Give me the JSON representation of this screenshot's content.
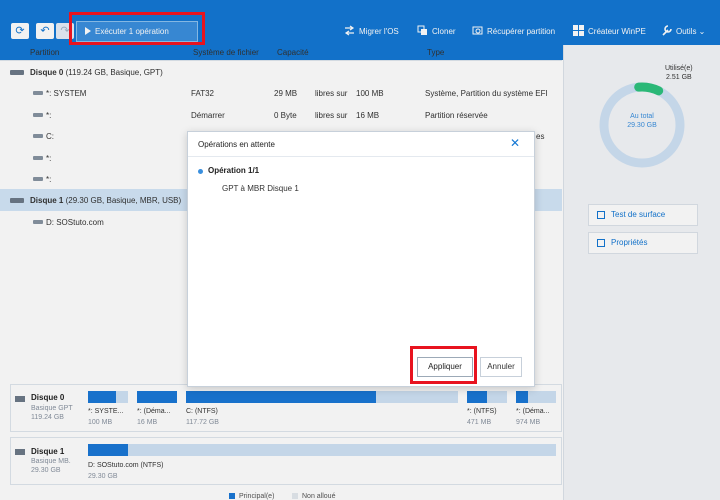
{
  "toolbar": {
    "refresh_icon": "refresh-icon",
    "undo_icon": "undo-icon",
    "redo_icon": "redo-icon",
    "run_label": "Exécuter 1 opération",
    "actions": [
      {
        "label": "Migrer l'OS",
        "icon": "migrate-icon"
      },
      {
        "label": "Cloner",
        "icon": "clone-icon"
      },
      {
        "label": "Récupérer partition",
        "icon": "recover-icon"
      },
      {
        "label": "Créateur WinPE",
        "icon": "windows-icon"
      },
      {
        "label": "Outils",
        "icon": "tools-icon"
      }
    ]
  },
  "table": {
    "headers": {
      "partition": "Partition",
      "fs": "Système de fichier",
      "capacity": "Capacité",
      "type": "Type"
    },
    "disk0": {
      "name": "Disque 0",
      "info": "(119.24 GB, Basique, GPT)"
    },
    "disk0_parts": [
      {
        "name": "*: SYSTEM",
        "fs": "FAT32",
        "used": "29 MB",
        "mid": "libres sur",
        "total": "100 MB",
        "type": "Système, Partition du système EFI"
      },
      {
        "name": "*:",
        "fs": "Démarrer",
        "used": "0 Byte",
        "mid": "libres sur",
        "total": "16 MB",
        "type": "Partition réservée"
      },
      {
        "name": "C:",
        "fs": "",
        "used": "",
        "mid": "",
        "total": "",
        "type": "es"
      },
      {
        "name": "*:",
        "fs": "",
        "used": "",
        "mid": "",
        "total": "",
        "type": ""
      },
      {
        "name": "*:",
        "fs": "",
        "used": "",
        "mid": "",
        "total": "",
        "type": ""
      }
    ],
    "disk1": {
      "name": "Disque 1",
      "info": "(29.30 GB, Basique, MBR, USB)"
    },
    "disk1_parts": [
      {
        "name": "D: SOStuto.com"
      }
    ]
  },
  "right_panel": {
    "used_label": "Utilisé(e)",
    "used_value": "2.51 GB",
    "total_label": "Au total",
    "total_value": "29.30 GB",
    "used_fraction": 0.086,
    "surface_test": "Test de surface",
    "properties": "Propriétés"
  },
  "disk_map": {
    "disk0": {
      "name": "Disque 0",
      "sub1": "Basique GPT",
      "sub2": "119.24 GB",
      "segments": [
        {
          "label": "*: SYSTE...",
          "size": "100 MB",
          "fill": 0.7
        },
        {
          "label": "*: (Déma...",
          "size": "16 MB",
          "fill": 1.0
        },
        {
          "label": "C: (NTFS)",
          "size": "117.72 GB",
          "fill": 0.7
        },
        {
          "label": "*: (NTFS)",
          "size": "471 MB",
          "fill": 0.5
        },
        {
          "label": "*: (Déma...",
          "size": "974 MB",
          "fill": 0.3
        }
      ]
    },
    "disk1": {
      "name": "Disque 1",
      "sub1": "Basique MB.",
      "sub2": "29.30 GB",
      "segments": [
        {
          "label": "D: SOStuto.com (NTFS)",
          "size": "29.30 GB",
          "fill": 0.086
        }
      ]
    },
    "legend": {
      "primary": "Principal(e)",
      "unallocated": "Non alloué"
    }
  },
  "dialog": {
    "title": "Opérations en attente",
    "close_icon": "close-icon",
    "op_title": "Opération 1/1",
    "op_desc": "GPT à MBR Disque 1",
    "apply": "Appliquer",
    "cancel": "Annuler"
  },
  "colors": {
    "toolbar": "#1478d4",
    "accent": "#1a78d6",
    "highlight": "#e8131f",
    "used_ring": "#2ec27e"
  }
}
